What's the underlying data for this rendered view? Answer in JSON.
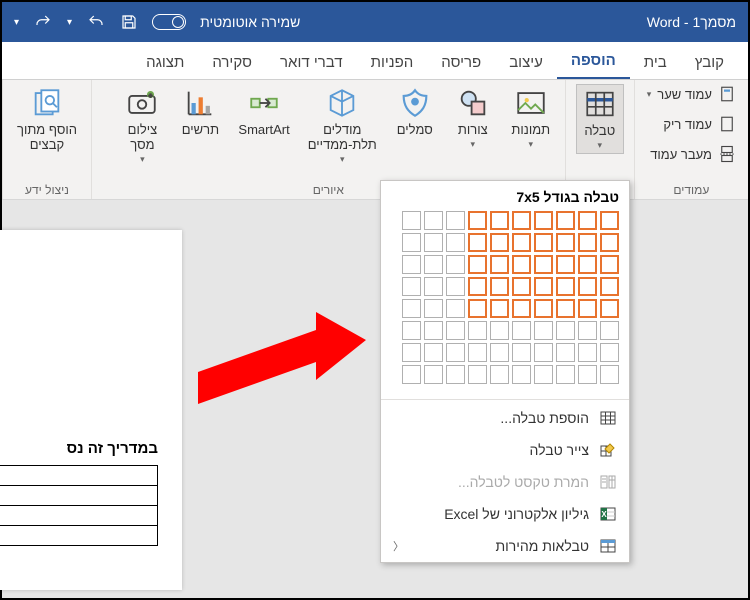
{
  "titlebar": {
    "title": "מסמך1 - Word",
    "autosave": "שמירה אוטומטית"
  },
  "tabs": {
    "file": "קובץ",
    "home": "בית",
    "insert": "הוספה",
    "design": "עיצוב",
    "layout": "פריסה",
    "references": "הפניות",
    "mailings": "דברי דואר",
    "review": "סקירה",
    "view": "תצוגה"
  },
  "groups": {
    "pages": {
      "label": "עמודים",
      "cover": "עמוד שער",
      "blank": "עמוד ריק",
      "break": "מעבר עמוד"
    },
    "tables": {
      "label": "",
      "table": "טבלה"
    },
    "illustrations": {
      "label": "איורים",
      "pictures": "תמונות",
      "shapes": "צורות",
      "icons": "סמלים",
      "models3d": "מודלים\nתלת-ממדיים",
      "smartart": "SmartArt",
      "chart": "תרשים",
      "screenshot": "צילום\nמסך"
    },
    "reuse": {
      "label": "ניצול ידע",
      "addfrom": "הוסף מתוך\nקבצים"
    }
  },
  "dropdown": {
    "title": "טבלה בגודל 7x5",
    "cols": 10,
    "rows": 8,
    "sel_cols": 7,
    "sel_rows": 5,
    "insert": "הוספת טבלה...",
    "draw": "צייר טבלה",
    "convert": "המרת טקסט לטבלה...",
    "excel": "גיליון אלקטרוני של Excel",
    "quick": "טבלאות מהירות"
  },
  "document": {
    "text": "במדריך זה נס"
  }
}
